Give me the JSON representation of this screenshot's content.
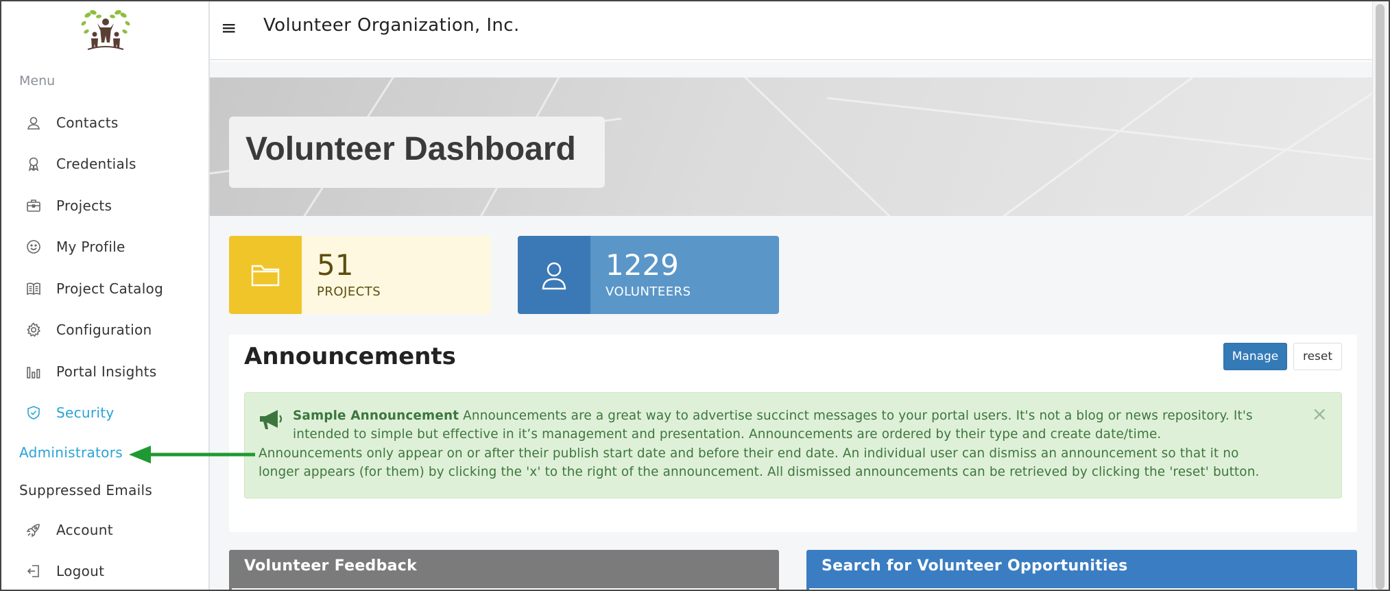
{
  "header": {
    "org_title": "Volunteer Organization, Inc.",
    "menu_icon": "hamburger-icon"
  },
  "sidebar": {
    "heading": "Menu",
    "items": [
      {
        "label": "Contacts",
        "icon": "contact-icon"
      },
      {
        "label": "Credentials",
        "icon": "award-icon"
      },
      {
        "label": "Projects",
        "icon": "briefcase-icon"
      },
      {
        "label": "My Profile",
        "icon": "smile-icon"
      },
      {
        "label": "Project Catalog",
        "icon": "book-icon"
      },
      {
        "label": "Configuration",
        "icon": "gear-icon"
      },
      {
        "label": "Portal Insights",
        "icon": "bar-chart-icon"
      },
      {
        "label": "Security",
        "icon": "shield-icon",
        "active": true
      }
    ],
    "sub_items": [
      {
        "label": "Administrators",
        "active": true
      },
      {
        "label": "Suppressed Emails"
      }
    ],
    "bottom_items": [
      {
        "label": "Account",
        "icon": "rocket-icon"
      },
      {
        "label": "Logout",
        "icon": "logout-icon"
      }
    ],
    "active_color": "#29a3d6"
  },
  "dashboard": {
    "title": "Volunteer Dashboard",
    "stats": [
      {
        "value": "51",
        "caption": "PROJECTS",
        "icon": "folder-icon",
        "color": "#f0c52a"
      },
      {
        "value": "1229",
        "caption": "VOLUNTEERS",
        "icon": "user-icon",
        "color": "#3a79b6"
      }
    ]
  },
  "announcements": {
    "title": "Announcements",
    "manage_label": "Manage",
    "reset_label": "reset",
    "close_glyph": "×",
    "item": {
      "icon": "megaphone-icon",
      "heading": "Sample Announcement",
      "line1": " Announcements are a great way to advertise succinct messages to your portal users. It's not a blog or news repository. It's",
      "line2": "intended to simple but effective in it’s management and presentation. Announcements are ordered by their type and create date/time.",
      "line3": "Announcements only appear on or after their publish start date and before their end date. An individual user can dismiss an announcement so that it no",
      "line4": "longer appears (for them) by clicking the 'x' to the right of the announcement. All dismissed announcements can be retrieved by clicking the 'reset' button."
    }
  },
  "panels": {
    "feedback_title": "Volunteer Feedback",
    "search_title": "Search for Volunteer Opportunities"
  },
  "annotation": {
    "arrow_color": "#1f9a32"
  }
}
